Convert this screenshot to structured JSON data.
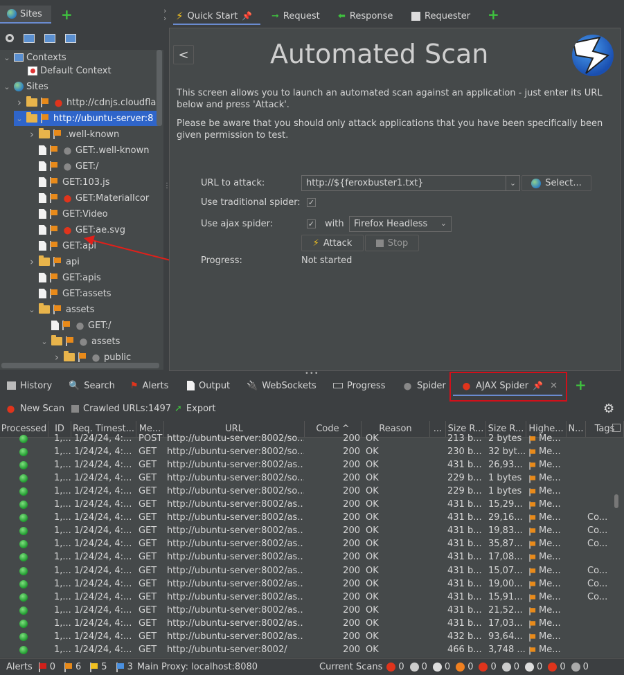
{
  "sites_panel": {
    "tab_label": "Sites"
  },
  "tree": {
    "contexts": "Contexts",
    "default_context": "Default Context",
    "sites": "Sites",
    "nodes": [
      {
        "label": "http://cdnjs.cloudfla",
        "level": 2,
        "kind": "folder",
        "bug": "red",
        "expand": "closed"
      },
      {
        "label": "http://ubuntu-server:8",
        "level": 2,
        "kind": "folder",
        "bug": "none",
        "expand": "open",
        "selected": true
      },
      {
        "label": ".well-known",
        "level": 3,
        "kind": "folder",
        "bug": "none",
        "expand": "closed"
      },
      {
        "label": "GET:.well-known",
        "level": 3,
        "kind": "file",
        "bug": "grey",
        "expand": "none"
      },
      {
        "label": "GET:/",
        "level": 3,
        "kind": "file",
        "bug": "grey",
        "expand": "none"
      },
      {
        "label": "GET:103.js",
        "level": 3,
        "kind": "file",
        "bug": "none",
        "expand": "none"
      },
      {
        "label": "GET:MaterialIcor",
        "level": 3,
        "kind": "file",
        "bug": "red",
        "expand": "none"
      },
      {
        "label": "GET:Video",
        "level": 3,
        "kind": "file",
        "bug": "none",
        "expand": "none"
      },
      {
        "label": "GET:ae.svg",
        "level": 3,
        "kind": "file",
        "bug": "red",
        "expand": "none"
      },
      {
        "label": "GET:api",
        "level": 3,
        "kind": "file",
        "bug": "none",
        "expand": "none"
      },
      {
        "label": "api",
        "level": 3,
        "kind": "folder",
        "bug": "none",
        "expand": "closed"
      },
      {
        "label": "GET:apis",
        "level": 3,
        "kind": "file",
        "bug": "none",
        "expand": "none"
      },
      {
        "label": "GET:assets",
        "level": 3,
        "kind": "file",
        "bug": "none",
        "expand": "none"
      },
      {
        "label": "assets",
        "level": 3,
        "kind": "folder",
        "bug": "none",
        "expand": "open"
      },
      {
        "label": "GET:/",
        "level": 4,
        "kind": "file",
        "bug": "grey",
        "expand": "none"
      },
      {
        "label": "assets",
        "level": 4,
        "kind": "folder",
        "bug": "grey",
        "expand": "open"
      },
      {
        "label": "public",
        "level": 5,
        "kind": "folder",
        "bug": "grey",
        "expand": "closed"
      }
    ]
  },
  "top_tabs": {
    "quick_start": "Quick Start",
    "request": "Request",
    "response": "Response",
    "requester": "Requester"
  },
  "quick_start": {
    "back_label": "<",
    "title": "Automated Scan",
    "intro": "This screen allows you to launch an automated scan against  an application - just enter its URL below and press 'Attack'.",
    "warning": "Please be aware that you should only attack applications that you have been specifically been given permission to test.",
    "url_label": "URL to attack:",
    "url_value": "http://${feroxbuster1.txt}",
    "select_label": "Select...",
    "trad_spider_label": "Use traditional spider:",
    "ajax_spider_label": "Use ajax spider:",
    "with_label": "with",
    "browser_value": "Firefox Headless",
    "attack_label": "Attack",
    "stop_label": "Stop",
    "progress_label": "Progress:",
    "progress_value": "Not started"
  },
  "bottom_tabs": {
    "history": "History",
    "search": "Search",
    "alerts": "Alerts",
    "output": "Output",
    "websockets": "WebSockets",
    "progress": "Progress",
    "spider": "Spider",
    "ajax_spider": "AJAX Spider"
  },
  "ajax_toolbar": {
    "new_scan": "New Scan",
    "crawled": "Crawled URLs:1497",
    "export": "Export"
  },
  "table": {
    "headers": [
      "Processed",
      "ID",
      "Req. Timest...",
      "Me...",
      "URL",
      "Code ^",
      "Reason",
      "...",
      "Size R...",
      "Size R...",
      "Highe...",
      "N...",
      "Tags"
    ],
    "rows": [
      [
        "1,...",
        "1/24/24, 4:...",
        "POST",
        "http://ubuntu-server:8002/so...",
        "200",
        "OK",
        "213 b...",
        "2 bytes",
        "Me...",
        ""
      ],
      [
        "1,...",
        "1/24/24, 4:...",
        "GET",
        "http://ubuntu-server:8002/so...",
        "200",
        "OK",
        "230 b...",
        "32 byt...",
        "Me...",
        ""
      ],
      [
        "1,...",
        "1/24/24, 4:...",
        "GET",
        "http://ubuntu-server:8002/as...",
        "200",
        "OK",
        "431 b...",
        "26,93...",
        "Me...",
        ""
      ],
      [
        "1,...",
        "1/24/24, 4:...",
        "GET",
        "http://ubuntu-server:8002/so...",
        "200",
        "OK",
        "229 b...",
        "1 bytes",
        "Me...",
        ""
      ],
      [
        "1,...",
        "1/24/24, 4:...",
        "GET",
        "http://ubuntu-server:8002/so...",
        "200",
        "OK",
        "229 b...",
        "1 bytes",
        "Me...",
        ""
      ],
      [
        "1,...",
        "1/24/24, 4:...",
        "GET",
        "http://ubuntu-server:8002/as...",
        "200",
        "OK",
        "431 b...",
        "15,29...",
        "Me...",
        ""
      ],
      [
        "1,...",
        "1/24/24, 4:...",
        "GET",
        "http://ubuntu-server:8002/as...",
        "200",
        "OK",
        "431 b...",
        "29,16...",
        "Me...",
        "Co..."
      ],
      [
        "1,...",
        "1/24/24, 4:...",
        "GET",
        "http://ubuntu-server:8002/as...",
        "200",
        "OK",
        "431 b...",
        "19,83...",
        "Me...",
        "Co..."
      ],
      [
        "1,...",
        "1/24/24, 4:...",
        "GET",
        "http://ubuntu-server:8002/as...",
        "200",
        "OK",
        "431 b...",
        "35,87...",
        "Me...",
        "Co..."
      ],
      [
        "1,...",
        "1/24/24, 4:...",
        "GET",
        "http://ubuntu-server:8002/as...",
        "200",
        "OK",
        "431 b...",
        "17,08...",
        "Me...",
        ""
      ],
      [
        "1,...",
        "1/24/24, 4:...",
        "GET",
        "http://ubuntu-server:8002/as...",
        "200",
        "OK",
        "431 b...",
        "15,07...",
        "Me...",
        "Co..."
      ],
      [
        "1,...",
        "1/24/24, 4:...",
        "GET",
        "http://ubuntu-server:8002/as...",
        "200",
        "OK",
        "431 b...",
        "19,00...",
        "Me...",
        "Co..."
      ],
      [
        "1,...",
        "1/24/24, 4:...",
        "GET",
        "http://ubuntu-server:8002/as...",
        "200",
        "OK",
        "431 b...",
        "15,91...",
        "Me...",
        "Co..."
      ],
      [
        "1,...",
        "1/24/24, 4:...",
        "GET",
        "http://ubuntu-server:8002/as...",
        "200",
        "OK",
        "431 b...",
        "21,52...",
        "Me...",
        ""
      ],
      [
        "1,...",
        "1/24/24, 4:...",
        "GET",
        "http://ubuntu-server:8002/as...",
        "200",
        "OK",
        "431 b...",
        "17,03...",
        "Me...",
        ""
      ],
      [
        "1,...",
        "1/24/24, 4:...",
        "GET",
        "http://ubuntu-server:8002/as...",
        "200",
        "OK",
        "432 b...",
        "93,64...",
        "Me...",
        ""
      ],
      [
        "1,...",
        "1/24/24, 4:...",
        "GET",
        "http://ubuntu-server:8002/",
        "200",
        "OK",
        "466 b...",
        "3,748 ...",
        "Me...",
        ""
      ]
    ]
  },
  "status_bar": {
    "alerts": "Alerts",
    "high": "0",
    "medium": "6",
    "low": "5",
    "info": "3",
    "proxy": "Main Proxy: localhost:8080",
    "current_scans": "Current Scans",
    "counts": [
      "0",
      "0",
      "0",
      "0",
      "0",
      "0",
      "0",
      "0",
      "0"
    ]
  },
  "colors": {
    "bg": "#3c3f41",
    "panel": "#45494a",
    "selection": "#2f65ca",
    "accent_red": "#d0101a",
    "green": "#3fc23f"
  }
}
